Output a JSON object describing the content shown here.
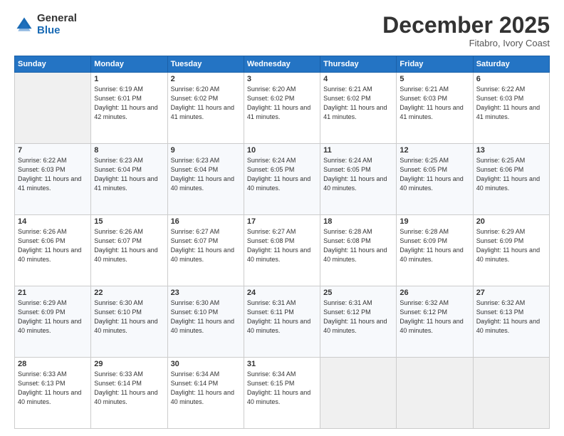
{
  "logo": {
    "general": "General",
    "blue": "Blue"
  },
  "header": {
    "month": "December 2025",
    "location": "Fitabro, Ivory Coast"
  },
  "days_of_week": [
    "Sunday",
    "Monday",
    "Tuesday",
    "Wednesday",
    "Thursday",
    "Friday",
    "Saturday"
  ],
  "weeks": [
    [
      {
        "day": "",
        "empty": true
      },
      {
        "day": "1",
        "sunrise": "6:19 AM",
        "sunset": "6:01 PM",
        "daylight": "11 hours and 42 minutes."
      },
      {
        "day": "2",
        "sunrise": "6:20 AM",
        "sunset": "6:02 PM",
        "daylight": "11 hours and 41 minutes."
      },
      {
        "day": "3",
        "sunrise": "6:20 AM",
        "sunset": "6:02 PM",
        "daylight": "11 hours and 41 minutes."
      },
      {
        "day": "4",
        "sunrise": "6:21 AM",
        "sunset": "6:02 PM",
        "daylight": "11 hours and 41 minutes."
      },
      {
        "day": "5",
        "sunrise": "6:21 AM",
        "sunset": "6:03 PM",
        "daylight": "11 hours and 41 minutes."
      },
      {
        "day": "6",
        "sunrise": "6:22 AM",
        "sunset": "6:03 PM",
        "daylight": "11 hours and 41 minutes."
      }
    ],
    [
      {
        "day": "7",
        "sunrise": "6:22 AM",
        "sunset": "6:03 PM",
        "daylight": "11 hours and 41 minutes."
      },
      {
        "day": "8",
        "sunrise": "6:23 AM",
        "sunset": "6:04 PM",
        "daylight": "11 hours and 41 minutes."
      },
      {
        "day": "9",
        "sunrise": "6:23 AM",
        "sunset": "6:04 PM",
        "daylight": "11 hours and 40 minutes."
      },
      {
        "day": "10",
        "sunrise": "6:24 AM",
        "sunset": "6:05 PM",
        "daylight": "11 hours and 40 minutes."
      },
      {
        "day": "11",
        "sunrise": "6:24 AM",
        "sunset": "6:05 PM",
        "daylight": "11 hours and 40 minutes."
      },
      {
        "day": "12",
        "sunrise": "6:25 AM",
        "sunset": "6:05 PM",
        "daylight": "11 hours and 40 minutes."
      },
      {
        "day": "13",
        "sunrise": "6:25 AM",
        "sunset": "6:06 PM",
        "daylight": "11 hours and 40 minutes."
      }
    ],
    [
      {
        "day": "14",
        "sunrise": "6:26 AM",
        "sunset": "6:06 PM",
        "daylight": "11 hours and 40 minutes."
      },
      {
        "day": "15",
        "sunrise": "6:26 AM",
        "sunset": "6:07 PM",
        "daylight": "11 hours and 40 minutes."
      },
      {
        "day": "16",
        "sunrise": "6:27 AM",
        "sunset": "6:07 PM",
        "daylight": "11 hours and 40 minutes."
      },
      {
        "day": "17",
        "sunrise": "6:27 AM",
        "sunset": "6:08 PM",
        "daylight": "11 hours and 40 minutes."
      },
      {
        "day": "18",
        "sunrise": "6:28 AM",
        "sunset": "6:08 PM",
        "daylight": "11 hours and 40 minutes."
      },
      {
        "day": "19",
        "sunrise": "6:28 AM",
        "sunset": "6:09 PM",
        "daylight": "11 hours and 40 minutes."
      },
      {
        "day": "20",
        "sunrise": "6:29 AM",
        "sunset": "6:09 PM",
        "daylight": "11 hours and 40 minutes."
      }
    ],
    [
      {
        "day": "21",
        "sunrise": "6:29 AM",
        "sunset": "6:09 PM",
        "daylight": "11 hours and 40 minutes."
      },
      {
        "day": "22",
        "sunrise": "6:30 AM",
        "sunset": "6:10 PM",
        "daylight": "11 hours and 40 minutes."
      },
      {
        "day": "23",
        "sunrise": "6:30 AM",
        "sunset": "6:10 PM",
        "daylight": "11 hours and 40 minutes."
      },
      {
        "day": "24",
        "sunrise": "6:31 AM",
        "sunset": "6:11 PM",
        "daylight": "11 hours and 40 minutes."
      },
      {
        "day": "25",
        "sunrise": "6:31 AM",
        "sunset": "6:12 PM",
        "daylight": "11 hours and 40 minutes."
      },
      {
        "day": "26",
        "sunrise": "6:32 AM",
        "sunset": "6:12 PM",
        "daylight": "11 hours and 40 minutes."
      },
      {
        "day": "27",
        "sunrise": "6:32 AM",
        "sunset": "6:13 PM",
        "daylight": "11 hours and 40 minutes."
      }
    ],
    [
      {
        "day": "28",
        "sunrise": "6:33 AM",
        "sunset": "6:13 PM",
        "daylight": "11 hours and 40 minutes."
      },
      {
        "day": "29",
        "sunrise": "6:33 AM",
        "sunset": "6:14 PM",
        "daylight": "11 hours and 40 minutes."
      },
      {
        "day": "30",
        "sunrise": "6:34 AM",
        "sunset": "6:14 PM",
        "daylight": "11 hours and 40 minutes."
      },
      {
        "day": "31",
        "sunrise": "6:34 AM",
        "sunset": "6:15 PM",
        "daylight": "11 hours and 40 minutes."
      },
      {
        "day": "",
        "empty": true
      },
      {
        "day": "",
        "empty": true
      },
      {
        "day": "",
        "empty": true
      }
    ]
  ],
  "labels": {
    "sunrise": "Sunrise:",
    "sunset": "Sunset:",
    "daylight": "Daylight:"
  }
}
